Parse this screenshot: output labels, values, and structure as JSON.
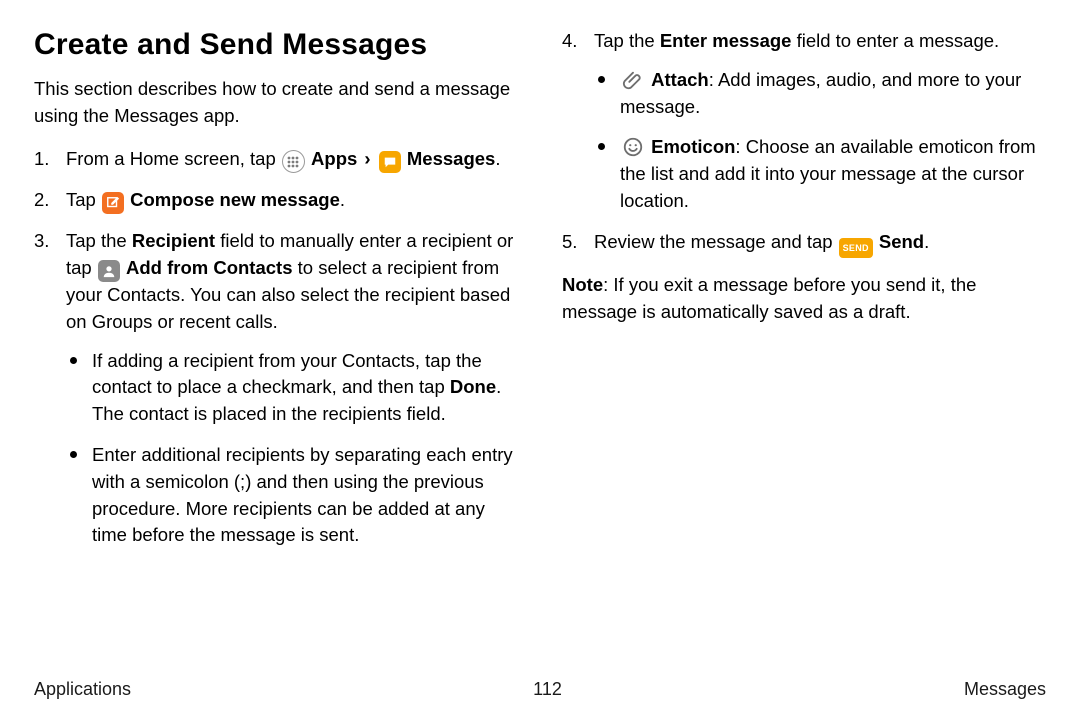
{
  "title": "Create and Send Messages",
  "intro": "This section describes how to create and send a message using the Messages app.",
  "labels": {
    "apps": "Apps",
    "messages": "Messages",
    "compose": "Compose new message",
    "recipient": "Recipient",
    "add_contacts": "Add from Contacts",
    "done": "Done",
    "enter_message": "Enter message",
    "attach": "Attach",
    "emoticon": "Emoticon",
    "send": "Send",
    "note_label": "Note"
  },
  "steps": {
    "s1_a": "From a Home screen, tap ",
    "s1_b": ".",
    "s2_a": "Tap ",
    "s2_b": ".",
    "s3_a": "Tap the ",
    "s3_b": " field to manually enter a recipient or tap ",
    "s3_c": " to select a recipient from your Contacts. You can also select the recipient based on Groups or recent calls.",
    "s3_sub1_a": "If adding a recipient from your Contacts, tap the contact to place a checkmark, and then tap ",
    "s3_sub1_b": ". The contact is placed in the recipients field.",
    "s3_sub2": "Enter additional recipients by separating each entry with a semicolon (;) and then using the previous procedure. More recipients can be added at any time before the message is sent.",
    "s4_a": "Tap the ",
    "s4_b": " field to enter a message.",
    "s4_sub1": ": Add images, audio, and more to your message.",
    "s4_sub2": ": Choose an available emoticon from the list and add it into your message at the cursor location.",
    "s5_a": "Review the message and tap ",
    "s5_b": "."
  },
  "note": ": If you exit a message before you send it, the message is automatically saved as a draft.",
  "footer": {
    "left": "Applications",
    "center": "112",
    "right": "Messages"
  }
}
